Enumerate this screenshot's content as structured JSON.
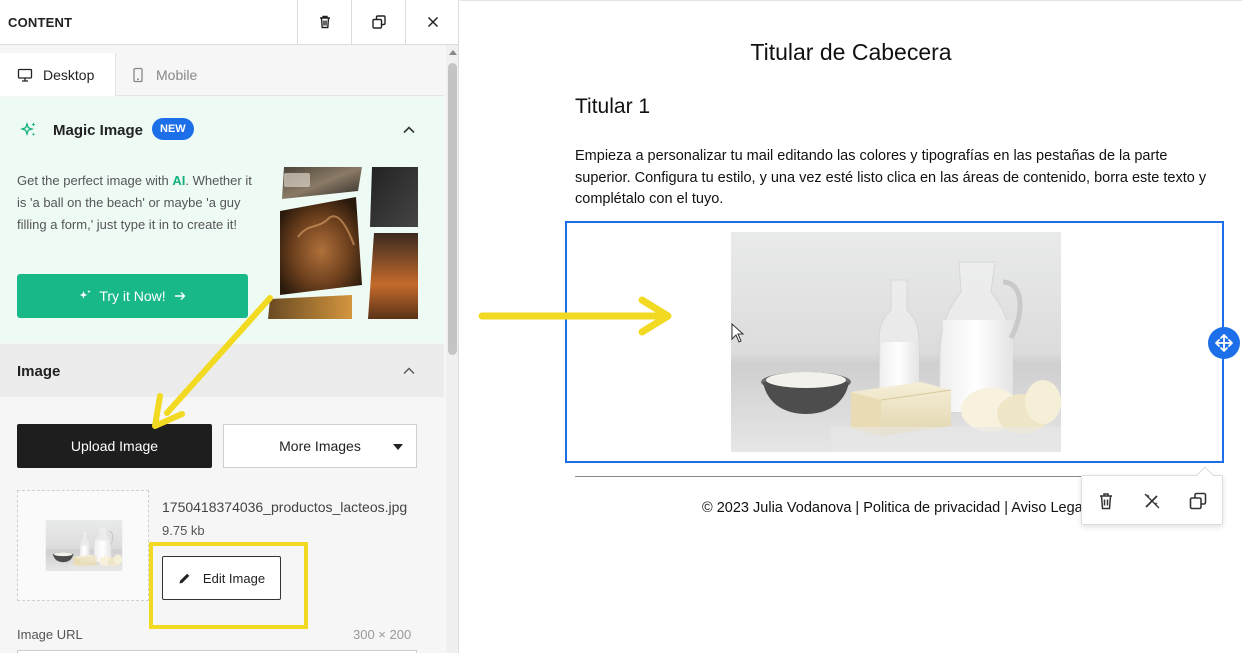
{
  "panel": {
    "title": "CONTENT",
    "tabs": [
      {
        "label": "Desktop",
        "icon": "desktop-icon",
        "active": true
      },
      {
        "label": "Mobile",
        "icon": "mobile-icon",
        "active": false
      }
    ]
  },
  "magic_image": {
    "title": "Magic Image",
    "badge": "NEW",
    "desc_pre": "Get the perfect image with ",
    "desc_ai": "AI",
    "desc_post": ". Whether it is 'a ball on the beach' or maybe 'a guy filling a form,' just type it in to create it!",
    "cta_label": "Try it Now!"
  },
  "image_section": {
    "title": "Image",
    "upload_label": "Upload Image",
    "more_label": "More Images",
    "file_name": "1750418374036_productos_lacteos.jpg",
    "file_size": "9.75 kb",
    "edit_label": "Edit Image",
    "url_label": "Image URL",
    "dimensions": "300 × 200"
  },
  "canvas": {
    "header_title": "Titular de Cabecera",
    "heading": "Titular 1",
    "body": "Empieza a personalizar tu mail editando las colores y tipografías en las pestañas de la parte superior. Configura tu estilo, y una vez esté listo clica en las áreas de contenido, borra este texto y complétalo con el tuyo.",
    "footer": "© 2023 Julia Vodanova | Politica de privacidad | Aviso Legal"
  },
  "colors": {
    "accent_blue": "#1c6fe8",
    "cta_green": "#19b888",
    "highlight_yellow": "#f2da22"
  }
}
